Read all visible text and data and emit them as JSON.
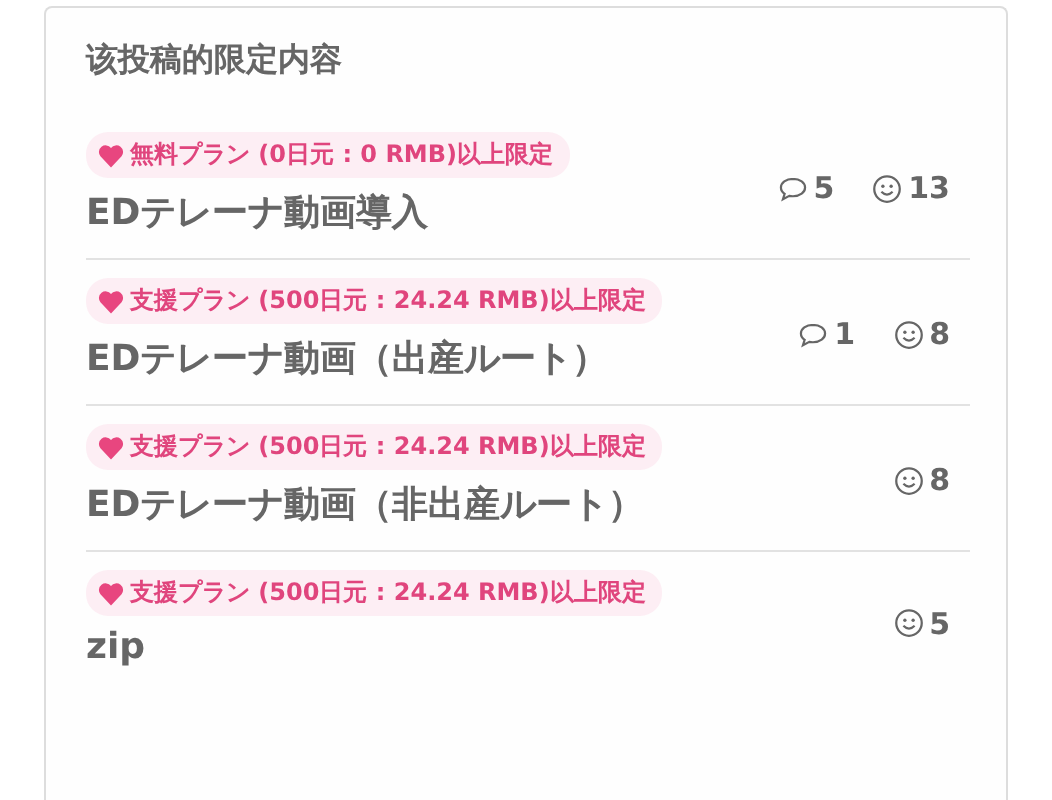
{
  "section_title": "该投稿的限定内容",
  "posts": [
    {
      "plan": "無料プラン (0日元 : 0 RMB)以上限定",
      "title": "EDテレーナ動画導入",
      "comments": "5",
      "reactions": "13"
    },
    {
      "plan": "支援プラン (500日元 : 24.24 RMB)以上限定",
      "title": "EDテレーナ動画（出産ルート）",
      "comments": "1",
      "reactions": "8"
    },
    {
      "plan": "支援プラン (500日元 : 24.24 RMB)以上限定",
      "title": "EDテレーナ動画（非出産ルート）",
      "reactions": "8"
    },
    {
      "plan": "支援プラン (500日元 : 24.24 RMB)以上限定",
      "title": "zip",
      "reactions": "5"
    }
  ]
}
